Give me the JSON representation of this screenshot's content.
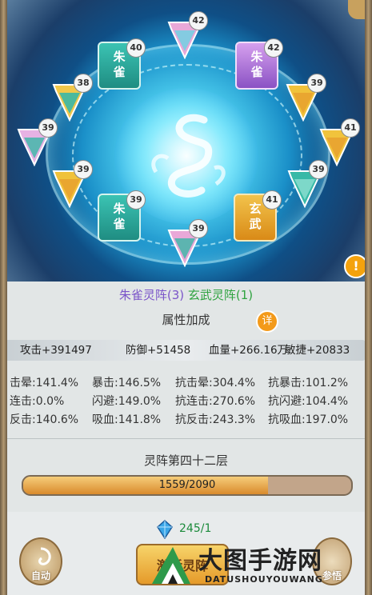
{
  "formation": {
    "zhuque_label": "朱雀灵阵(3)",
    "xuanwu_label": "玄武灵阵(1)"
  },
  "banners": [
    {
      "level": "42",
      "color": "#e9a8d8"
    },
    {
      "level": "40",
      "color": "#2fb3a3",
      "glyph": "朱\n雀"
    },
    {
      "level": "42",
      "color": "#c88be0",
      "glyph": "朱\n雀"
    },
    {
      "level": "38",
      "color": "#f2c84a"
    },
    {
      "level": "39",
      "color": "#f0c23b"
    },
    {
      "level": "39",
      "color": "#e7b2e4"
    },
    {
      "level": "41",
      "color": "#f1c33c"
    },
    {
      "level": "39",
      "color": "#f0c23b"
    },
    {
      "level": "39",
      "color": "#38b9a7"
    },
    {
      "level": "39",
      "color": "#2fb3a3",
      "glyph": "朱\n雀"
    },
    {
      "level": "41",
      "color": "#efb530",
      "glyph": "玄\n武"
    },
    {
      "level": "39",
      "color": "#e9a8d8"
    }
  ],
  "warning_icon": "!",
  "attributes": {
    "header": "属性加成",
    "detail_button": "详",
    "bar": {
      "attack": "攻击+391497",
      "defense": "防御+51458",
      "hp": "血量+266.16万",
      "agility": "敏捷+20833"
    },
    "stats": [
      [
        "击晕:141.4%",
        "暴击:146.5%",
        "抗击晕:304.4%",
        "抗暴击:101.2%"
      ],
      [
        "连击:0.0%",
        "闪避:149.0%",
        "抗连击:270.6%",
        "抗闪避:104.4%"
      ],
      [
        "反击:140.6%",
        "吸血:141.8%",
        "抗反击:243.3%",
        "抗吸血:197.0%"
      ]
    ]
  },
  "layer": {
    "title": "灵阵第四十二层",
    "progress_text": "1559/2090",
    "progress_fraction": 0.746
  },
  "bottom": {
    "gem_count": "245/1",
    "auto_label": "自动",
    "main_label": "激活灵阵",
    "right_label": "参悟"
  },
  "watermark": {
    "title": "大图手游网",
    "subtitle": "DATUSHOUYOUWANG"
  }
}
